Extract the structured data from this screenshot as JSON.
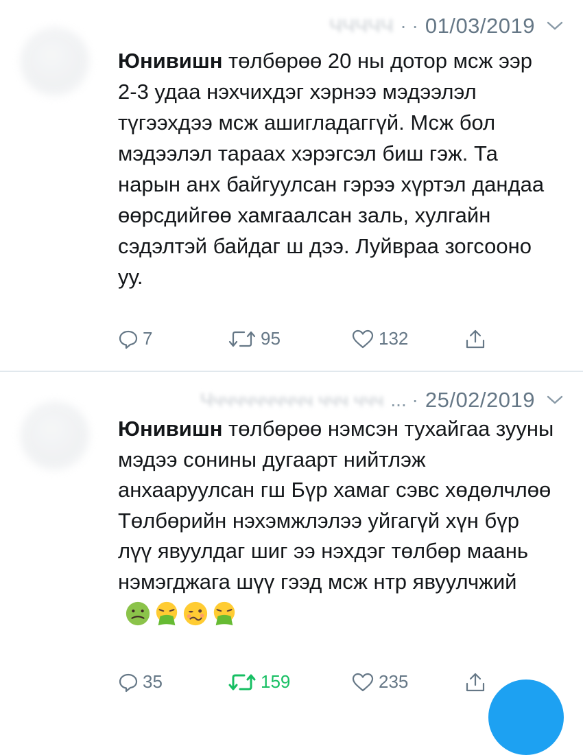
{
  "tweets": [
    {
      "author_blurred": "ЧЧЧЧЧ",
      "separator": "· ·",
      "date": "01/03/2019",
      "bold_lead": "Юнивишн",
      "text": " төлбөрөө 20 ны дотор мсж ээр 2-3 удаа нэхчихдэг хэрнээ мэдээлэл түгээхдээ мсж ашигладаггүй. Мсж бол мэдээлэл тараах хэрэгсэл биш гэж. Та нарын анх байгуулсан гэрээ хүртэл дандаа өөрсдийгөө хамгаалсан заль, хулгайн сэдэлтэй байдаг ш дээ. Луйвраа зогсооно уу.",
      "reply_count": "7",
      "retweet_count": "95",
      "like_count": "132"
    },
    {
      "author_blurred": "Ччччччччччч ччч ччч",
      "separator": "... ·",
      "date": "25/02/2019",
      "bold_lead": "Юнивишн",
      "text_line1": " төлбөрөө нэмсэн тухайгаа зууны мэдээ сонины дугаарт нийтлэж анхааруулсан гш Бүр хамаг сэвс хөдөлчлөө",
      "text_line2": "Төлбөрийн нэхэмжлэлээ уйгагүй хүн бүр лүү явуулдаг шиг ээ нэхдэг төлбөр маань нэмэгджага шүү гээд мсж нтр явуулчжий",
      "emojis": [
        "nauseated-face-emoji",
        "vomiting-face-emoji",
        "woozy-face-emoji",
        "vomiting-face-emoji"
      ],
      "reply_count": "35",
      "retweet_count": "159",
      "like_count": "235"
    }
  ],
  "colors": {
    "text": "#14171a",
    "muted": "#657786",
    "retweeted": "#17bf63",
    "accent": "#1da1f2",
    "divider": "#e1e8ed"
  },
  "icons": [
    "reply-icon",
    "retweet-icon",
    "like-icon",
    "share-icon",
    "chevron-down-icon"
  ]
}
